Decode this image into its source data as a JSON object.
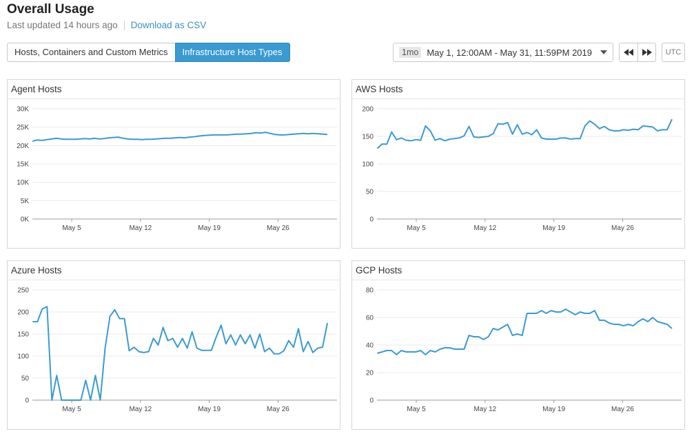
{
  "header": {
    "title": "Overall Usage",
    "last_updated": "Last updated 14 hours ago",
    "download_link": "Download as CSV"
  },
  "tabs": [
    {
      "label": "Hosts, Containers and Custom Metrics",
      "active": false
    },
    {
      "label": "Infrastructure Host Types",
      "active": true
    }
  ],
  "time_range": {
    "badge": "1mo",
    "label": "May 1, 12:00AM - May 31, 11:59PM 2019"
  },
  "controls": {
    "prev_icon": "rewind-icon",
    "next_icon": "fast-forward-icon",
    "timezone_label": "UTC"
  },
  "colors": {
    "accent": "#3a9ad2",
    "series": "#3a9ad2",
    "link": "#3a8ec4"
  },
  "chart_data": [
    {
      "title": "Agent Hosts",
      "type": "line",
      "xticks": [
        "May 5",
        "May 12",
        "May 19",
        "May 26"
      ],
      "yticks": [
        "0K",
        "5K",
        "10K",
        "15K",
        "20K",
        "25K",
        "30K"
      ],
      "ylim": [
        0,
        30000
      ],
      "grid": "horizontal",
      "series": [
        {
          "values": [
            21200,
            21500,
            21400,
            21600,
            21800,
            22000,
            21800,
            21700,
            21700,
            21700,
            21800,
            21900,
            21800,
            22000,
            21800,
            21900,
            22100,
            22200,
            22300,
            22000,
            21800,
            21700,
            21700,
            21600,
            21700,
            21700,
            21800,
            21900,
            22000,
            22000,
            22100,
            22200,
            22100,
            22300,
            22400,
            22600,
            22700,
            22800,
            22900,
            22900,
            22900,
            22900,
            23000,
            23100,
            23100,
            23200,
            23300,
            23500,
            23400,
            23600,
            23300,
            23000,
            22900,
            22900,
            23000,
            23100,
            23200,
            23300,
            23200,
            23300,
            23200,
            23100,
            23000
          ]
        }
      ]
    },
    {
      "title": "AWS Hosts",
      "type": "line",
      "xticks": [
        "May 5",
        "May 12",
        "May 19",
        "May 26"
      ],
      "yticks": [
        "0",
        "50",
        "100",
        "150",
        "200"
      ],
      "ylim": [
        0,
        200
      ],
      "grid": "horizontal",
      "series": [
        {
          "values": [
            128,
            136,
            136,
            158,
            144,
            147,
            143,
            142,
            144,
            143,
            169,
            160,
            143,
            146,
            142,
            145,
            146,
            147,
            151,
            168,
            149,
            148,
            149,
            150,
            155,
            173,
            172,
            175,
            154,
            171,
            154,
            157,
            153,
            162,
            147,
            145,
            145,
            145,
            147,
            147,
            145,
            146,
            146,
            169,
            178,
            172,
            164,
            168,
            162,
            160,
            160,
            162,
            161,
            163,
            162,
            169,
            168,
            167,
            160,
            162,
            162,
            181
          ]
        }
      ]
    },
    {
      "title": "Azure Hosts",
      "type": "line",
      "xticks": [
        "May 5",
        "May 12",
        "May 19",
        "May 26"
      ],
      "yticks": [
        "0",
        "50",
        "100",
        "150",
        "200",
        "250"
      ],
      "ylim": [
        0,
        250
      ],
      "grid": "horizontal",
      "series": [
        {
          "values": [
            178,
            178,
            207,
            212,
            0,
            56,
            0,
            0,
            0,
            0,
            0,
            45,
            0,
            56,
            0,
            118,
            190,
            205,
            185,
            185,
            112,
            120,
            110,
            108,
            110,
            140,
            125,
            165,
            135,
            140,
            120,
            140,
            118,
            155,
            118,
            113,
            113,
            113,
            143,
            170,
            128,
            148,
            125,
            148,
            128,
            148,
            118,
            150,
            110,
            118,
            105,
            105,
            112,
            135,
            120,
            162,
            110,
            133,
            108,
            118,
            120,
            175
          ]
        }
      ]
    },
    {
      "title": "GCP Hosts",
      "type": "line",
      "xticks": [
        "May 5",
        "May 12",
        "May 19",
        "May 26"
      ],
      "yticks": [
        "0",
        "20",
        "40",
        "60",
        "80"
      ],
      "ylim": [
        0,
        80
      ],
      "grid": "horizontal",
      "series": [
        {
          "values": [
            34,
            35,
            36,
            36,
            33,
            36,
            35,
            35,
            35,
            36,
            33,
            36,
            35,
            37,
            38,
            38,
            37,
            37,
            37,
            47,
            46,
            46,
            44,
            46,
            52,
            51,
            53,
            55,
            47,
            48,
            47,
            63,
            63,
            63,
            65,
            63,
            65,
            64,
            64,
            66,
            64,
            62,
            64,
            63,
            63,
            65,
            58,
            58,
            56,
            55,
            55,
            54,
            55,
            54,
            57,
            59,
            57,
            60,
            57,
            56,
            55,
            52
          ]
        }
      ]
    }
  ]
}
